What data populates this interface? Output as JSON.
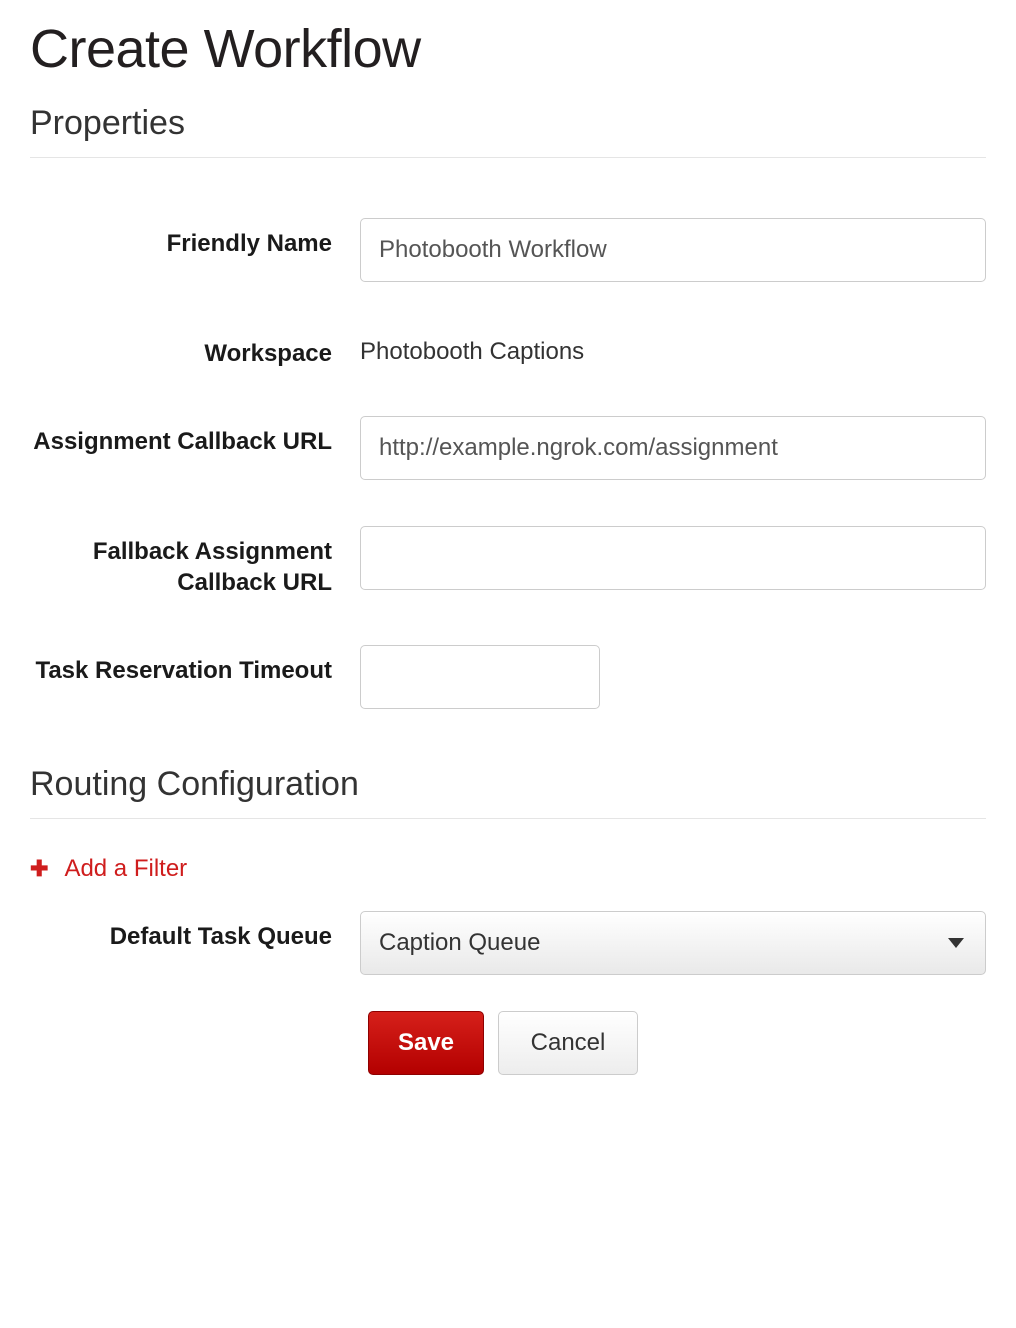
{
  "page": {
    "title": "Create Workflow"
  },
  "sections": {
    "properties": "Properties",
    "routing": "Routing Configuration"
  },
  "labels": {
    "friendly_name": "Friendly Name",
    "workspace": "Workspace",
    "assignment_callback_url": "Assignment Callback URL",
    "fallback_assignment_callback_url": "Fallback Assignment Callback URL",
    "task_reservation_timeout": "Task Reservation Timeout",
    "default_task_queue": "Default Task Queue"
  },
  "values": {
    "friendly_name": "Photobooth Workflow",
    "workspace": "Photobooth Captions",
    "assignment_callback_url": "http://example.ngrok.com/assignment",
    "fallback_assignment_callback_url": "",
    "task_reservation_timeout": "",
    "default_task_queue": "Caption Queue"
  },
  "actions": {
    "add_filter": "Add a Filter",
    "save": "Save",
    "cancel": "Cancel"
  }
}
